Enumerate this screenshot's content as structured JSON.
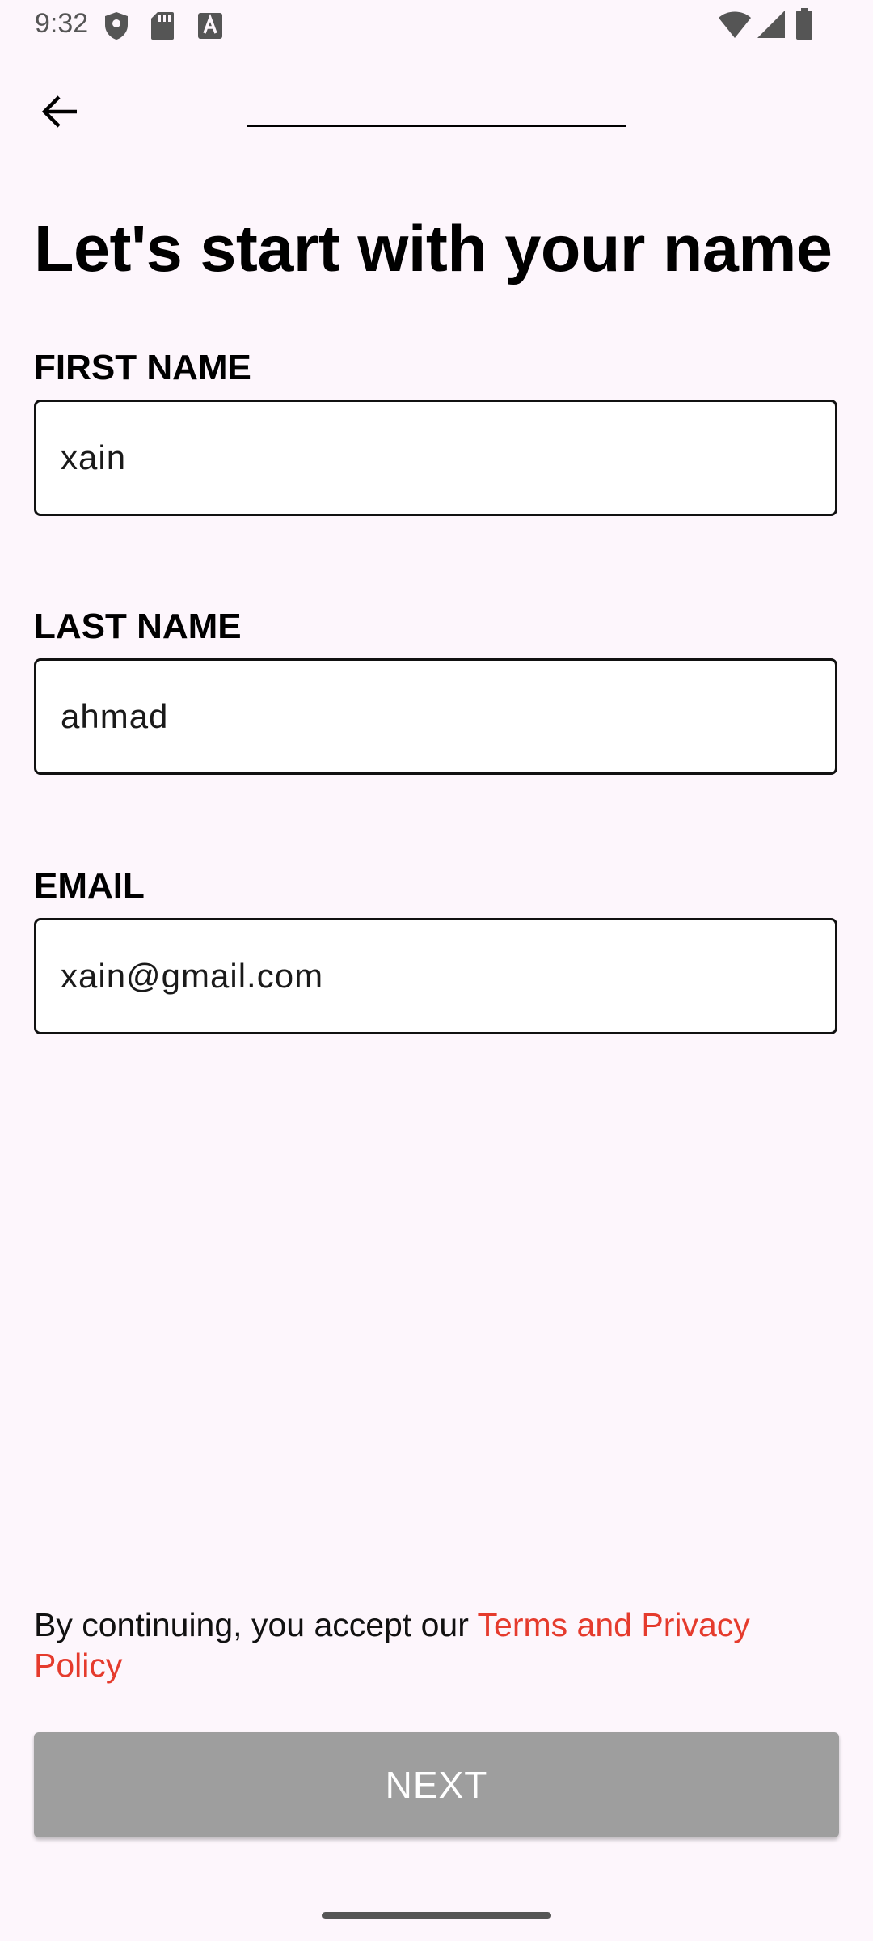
{
  "status_bar": {
    "time": "9:32",
    "left_icons": [
      "shield-icon",
      "sd-card-icon",
      "keyboard-a-icon"
    ],
    "right_icons": [
      "wifi-icon",
      "signal-icon",
      "battery-icon"
    ]
  },
  "app_bar": {
    "back_icon": "arrow-back-icon"
  },
  "title": "Let's start with your name",
  "fields": {
    "first_name": {
      "label": "FIRST NAME",
      "value": "xain"
    },
    "last_name": {
      "label": "LAST NAME",
      "value": "ahmad"
    },
    "email": {
      "label": "EMAIL",
      "value": "xain@gmail.com"
    }
  },
  "terms": {
    "prefix": "By continuing, you accept our ",
    "link": "Terms and Privacy Policy"
  },
  "next_button": {
    "label": "NEXT"
  },
  "colors": {
    "background": "#fdf6fc",
    "link": "#e53b2d",
    "button_disabled": "#9e9e9e"
  }
}
